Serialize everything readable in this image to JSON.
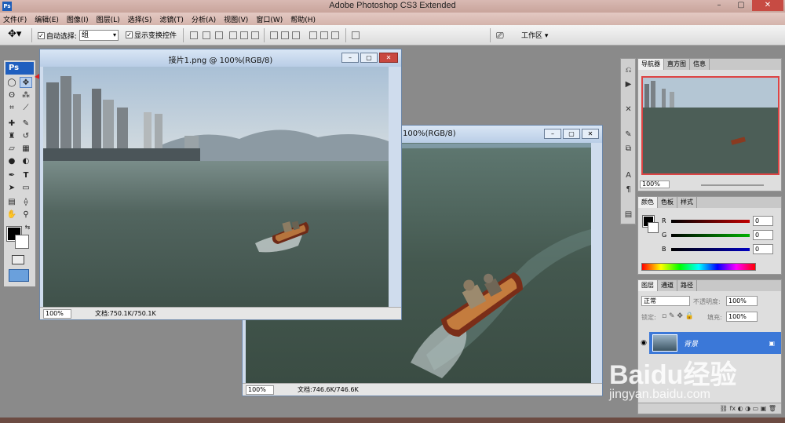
{
  "app": {
    "title": "Adobe Photoshop CS3 Extended",
    "icon_label": "Ps",
    "window_buttons": [
      "–",
      "▢",
      "✕"
    ]
  },
  "menu": [
    "文件(F)",
    "编辑(E)",
    "图像(I)",
    "图层(L)",
    "选择(S)",
    "滤镜(T)",
    "分析(A)",
    "视图(V)",
    "窗口(W)",
    "帮助(H)"
  ],
  "options": {
    "auto_select_label": "自动选择:",
    "auto_select_value": "组",
    "show_transform_label": "显示变换控件",
    "workspace_label": "工作区 ▾"
  },
  "toolbox": {
    "logo": "Ps"
  },
  "doc_front": {
    "title": "接片1.png @ 100%(RGB/8)",
    "zoom": "100%",
    "doc_info": "文档:750.1K/750.1K"
  },
  "doc_back": {
    "title": "100%(RGB/8)",
    "zoom": "100%",
    "doc_info": "文档:746.6K/746.6K"
  },
  "navigator": {
    "tabs": [
      "导航器",
      "直方图",
      "信息"
    ],
    "zoom": "100%"
  },
  "color_panel": {
    "tabs": [
      "颜色",
      "色板",
      "样式"
    ],
    "rows": [
      {
        "label": "R",
        "value": "0",
        "color": "#c00000"
      },
      {
        "label": "G",
        "value": "0",
        "color": "#00b000"
      },
      {
        "label": "B",
        "value": "0",
        "color": "#0000c0"
      }
    ]
  },
  "layers_panel": {
    "tabs": [
      "图层",
      "通道",
      "路径"
    ],
    "blend_mode": "正常",
    "opacity_label": "不透明度:",
    "opacity_value": "100%",
    "lock_label": "锁定:",
    "fill_label": "填充:",
    "fill_value": "100%",
    "layer_name": "背景"
  },
  "watermark": {
    "brand": "Baidu经验",
    "url": "jingyan.baidu.com"
  }
}
